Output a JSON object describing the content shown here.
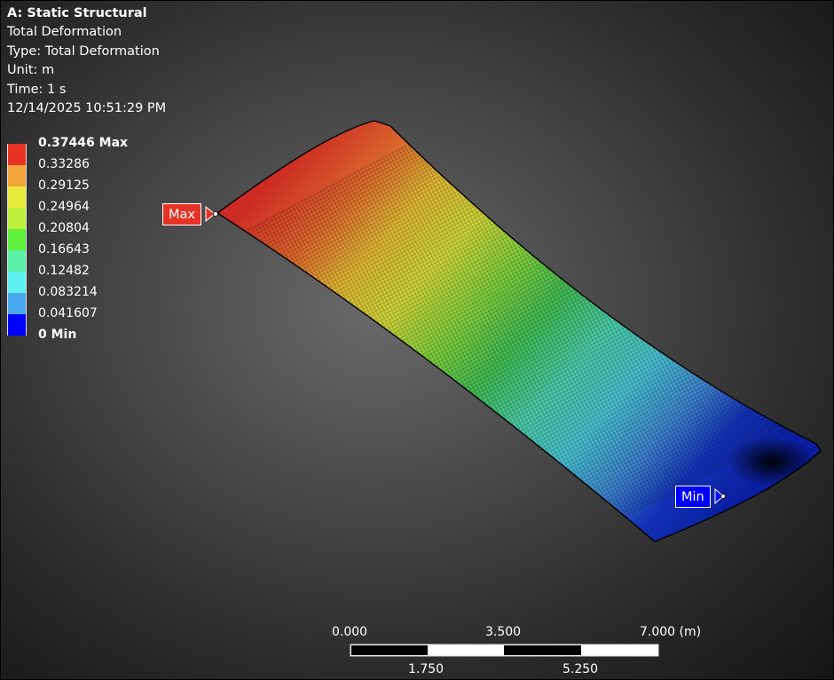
{
  "info": {
    "title": "A: Static Structural",
    "result_name": "Total Deformation",
    "type": "Type: Total Deformation",
    "unit": "Unit: m",
    "time": "Time: 1 s",
    "timestamp": "12/14/2025 10:51:29 PM"
  },
  "legend": {
    "max_label": "0.37446 Max",
    "values": [
      "0.33286",
      "0.29125",
      "0.24964",
      "0.20804",
      "0.16643",
      "0.12482",
      "0.083214",
      "0.041607"
    ],
    "min_label": "0 Min",
    "colors": [
      "#e73226",
      "#f0a43a",
      "#eaea3e",
      "#bff03a",
      "#5ef03c",
      "#5cf0a8",
      "#5ef0f0",
      "#4aa8f0",
      "#0000ff"
    ]
  },
  "probes": {
    "max_label": "Max",
    "min_label": "Min"
  },
  "scale_bar": {
    "top_labels": [
      "0.000",
      "3.500",
      "7.000 (m)"
    ],
    "bottom_labels": [
      "1.750",
      "5.250"
    ]
  }
}
